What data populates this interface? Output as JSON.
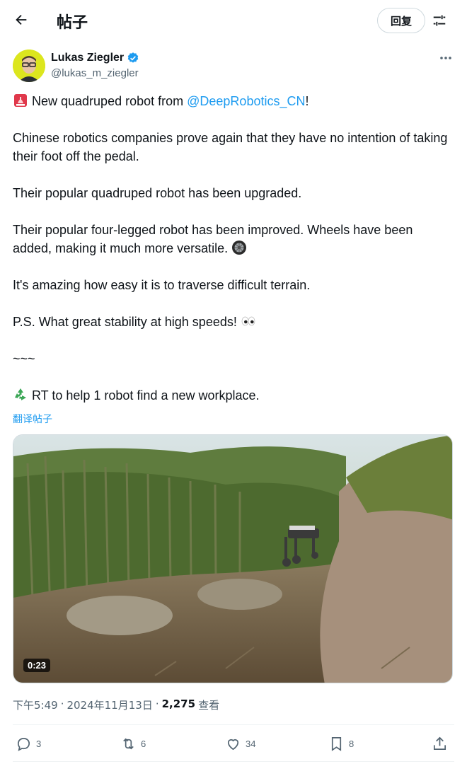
{
  "header": {
    "title": "帖子",
    "reply_label": "回复",
    "back_icon": "arrow-left-icon",
    "settings_icon": "sliders-icon"
  },
  "author": {
    "name": "Lukas Ziegler",
    "handle": "@lukas_m_ziegler",
    "verified": true,
    "verified_color": "#1d9bf0"
  },
  "tweet": {
    "line1_pre": " New quadruped robot from ",
    "line1_mention": "@DeepRobotics_CN",
    "line1_post": "!",
    "p2": "Chinese robotics companies prove again that they have no intention of taking their foot off the pedal.",
    "p3": "Their popular quadruped robot has been upgraded.",
    "p4": "Their popular four-legged robot has been improved. Wheels have been added, making it much more versatile. ",
    "p5": "It's amazing how easy it is to traverse difficult terrain.",
    "p6": "P.S. What great stability at high speeds! ",
    "p7": "~~~",
    "p8": " RT to help 1 robot find a new workplace.",
    "emojis": [
      "siren-emoji",
      "wheel-emoji",
      "eyes-emoji",
      "recycle-emoji"
    ]
  },
  "translate_label": "翻译帖子",
  "media": {
    "duration": "0:23"
  },
  "meta": {
    "time": "下午5:49",
    "sep1": "·",
    "date": "2024年11月13日",
    "sep2": "·",
    "views_count": "2,275",
    "views_label": "查看"
  },
  "actions": {
    "replies": "3",
    "reposts": "6",
    "likes": "34",
    "bookmarks": "8"
  },
  "colors": {
    "accent": "#1d9bf0",
    "text": "#0f1419",
    "secondary": "#536471"
  }
}
